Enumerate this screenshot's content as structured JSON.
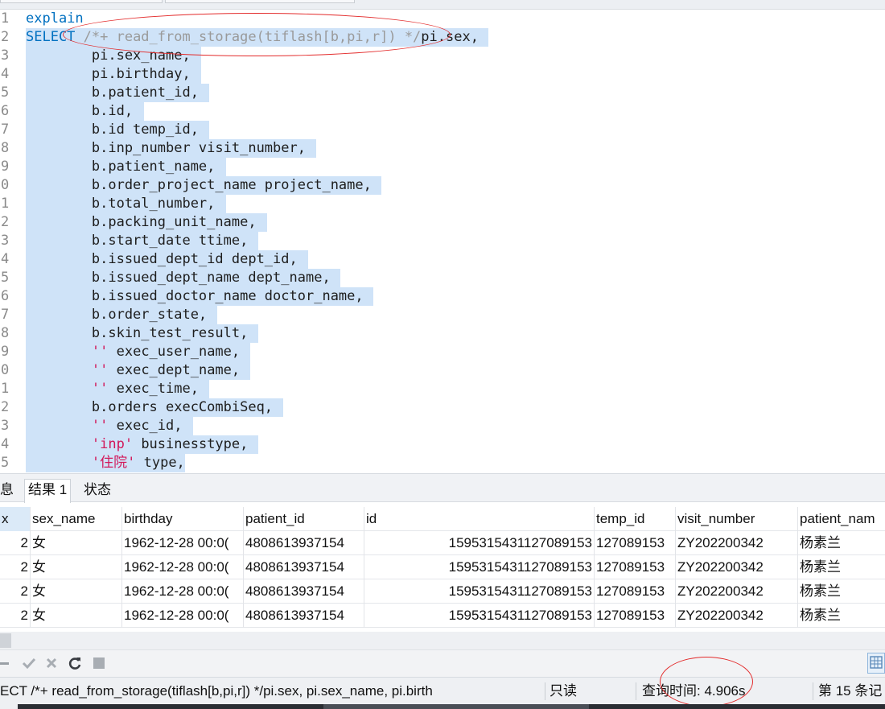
{
  "editor": {
    "lines": [
      {
        "num": "1",
        "tokens": [
          {
            "t": "explain",
            "c": "kw"
          }
        ]
      },
      {
        "num": "2",
        "tokens": [
          {
            "t": "SELECT ",
            "c": "kw"
          },
          {
            "t": "/*+ read_from_storage(tiflash[b,pi,r]) */",
            "c": "cm"
          },
          {
            "t": "pi.sex,",
            "c": "tx"
          }
        ]
      },
      {
        "num": "3",
        "tokens": [
          {
            "t": "        pi.sex_name,",
            "c": "tx"
          }
        ]
      },
      {
        "num": "4",
        "tokens": [
          {
            "t": "        pi.birthday,",
            "c": "tx"
          }
        ]
      },
      {
        "num": "5",
        "tokens": [
          {
            "t": "        b.patient_id,",
            "c": "tx"
          }
        ]
      },
      {
        "num": "6",
        "tokens": [
          {
            "t": "        b.id,",
            "c": "tx"
          }
        ]
      },
      {
        "num": "7",
        "tokens": [
          {
            "t": "        b.id temp_id,",
            "c": "tx"
          }
        ]
      },
      {
        "num": "8",
        "tokens": [
          {
            "t": "        b.inp_number visit_number,",
            "c": "tx"
          }
        ]
      },
      {
        "num": "9",
        "tokens": [
          {
            "t": "        b.patient_name,",
            "c": "tx"
          }
        ]
      },
      {
        "num": "0",
        "tokens": [
          {
            "t": "        b.order_project_name project_name,",
            "c": "tx"
          }
        ]
      },
      {
        "num": "1",
        "tokens": [
          {
            "t": "        b.total_number,",
            "c": "tx"
          }
        ]
      },
      {
        "num": "2",
        "tokens": [
          {
            "t": "        b.packing_unit_name,",
            "c": "tx"
          }
        ]
      },
      {
        "num": "3",
        "tokens": [
          {
            "t": "        b.start_date ttime,",
            "c": "tx"
          }
        ]
      },
      {
        "num": "4",
        "tokens": [
          {
            "t": "        b.issued_dept_id dept_id,",
            "c": "tx"
          }
        ]
      },
      {
        "num": "5",
        "tokens": [
          {
            "t": "        b.issued_dept_name dept_name,",
            "c": "tx"
          }
        ]
      },
      {
        "num": "6",
        "tokens": [
          {
            "t": "        b.issued_doctor_name doctor_name,",
            "c": "tx"
          }
        ]
      },
      {
        "num": "7",
        "tokens": [
          {
            "t": "        b.order_state,",
            "c": "tx"
          }
        ]
      },
      {
        "num": "8",
        "tokens": [
          {
            "t": "        b.skin_test_result,",
            "c": "tx"
          }
        ]
      },
      {
        "num": "9",
        "tokens": [
          {
            "t": "        ",
            "c": "tx"
          },
          {
            "t": "''",
            "c": "str"
          },
          {
            "t": " exec_user_name,",
            "c": "tx"
          }
        ]
      },
      {
        "num": "0",
        "tokens": [
          {
            "t": "        ",
            "c": "tx"
          },
          {
            "t": "''",
            "c": "str"
          },
          {
            "t": " exec_dept_name,",
            "c": "tx"
          }
        ]
      },
      {
        "num": "1",
        "tokens": [
          {
            "t": "        ",
            "c": "tx"
          },
          {
            "t": "''",
            "c": "str"
          },
          {
            "t": " exec_time,",
            "c": "tx"
          }
        ]
      },
      {
        "num": "2",
        "tokens": [
          {
            "t": "        b.orders execCombiSeq,",
            "c": "tx"
          }
        ]
      },
      {
        "num": "3",
        "tokens": [
          {
            "t": "        ",
            "c": "tx"
          },
          {
            "t": "''",
            "c": "str"
          },
          {
            "t": " exec_id,",
            "c": "tx"
          }
        ]
      },
      {
        "num": "4",
        "tokens": [
          {
            "t": "        ",
            "c": "tx"
          },
          {
            "t": "'inp'",
            "c": "str"
          },
          {
            "t": " businesstype,",
            "c": "tx"
          }
        ]
      },
      {
        "num": "5",
        "tokens": [
          {
            "t": "        ",
            "c": "tx"
          },
          {
            "t": "'住院'",
            "c": "str"
          },
          {
            "t": " type,",
            "c": "tx"
          }
        ]
      }
    ]
  },
  "result_tabs": [
    {
      "label": "息",
      "active": false
    },
    {
      "label": "结果 1",
      "active": true
    },
    {
      "label": "状态",
      "active": false
    }
  ],
  "grid": {
    "columns": [
      "x",
      "sex_name",
      "birthday",
      "patient_id",
      "id",
      "temp_id",
      "visit_number",
      "patient_nam"
    ],
    "rows": [
      [
        "2",
        "女",
        "1962-12-28 00:0(",
        "4808613937154",
        "1595315431127089153",
        "127089153",
        "ZY202200342",
        "杨素兰"
      ],
      [
        "2",
        "女",
        "1962-12-28 00:0(",
        "4808613937154",
        "1595315431127089153",
        "127089153",
        "ZY202200342",
        "杨素兰"
      ],
      [
        "2",
        "女",
        "1962-12-28 00:0(",
        "4808613937154",
        "1595315431127089153",
        "127089153",
        "ZY202200342",
        "杨素兰"
      ],
      [
        "2",
        "女",
        "1962-12-28 00:0(",
        "4808613937154",
        "1595315431127089153",
        "127089153",
        "ZY202200342",
        "杨素兰"
      ]
    ]
  },
  "status": {
    "query_text": "ECT /*+ read_from_storage(tiflash[b,pi,r]) */pi.sex,       pi.sex_name,      pi.birth",
    "mode": "只读",
    "query_time": "查询时间: 4.906s",
    "record_position": "第 15 条记"
  },
  "colors": {
    "selection": "#cfe3f8",
    "keyword": "#0070c0",
    "comment": "#9a9a9a",
    "string": "#d2185a",
    "annotation": "#e32b2b"
  }
}
